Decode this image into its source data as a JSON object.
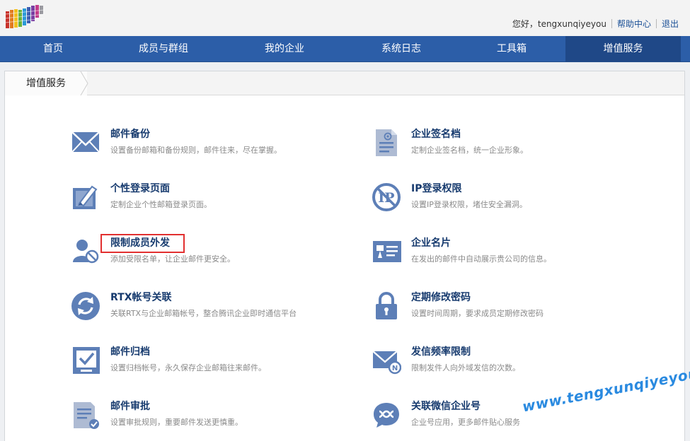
{
  "header": {
    "greeting": "您好，tengxunqiyeyou",
    "help_link": "帮助中心",
    "logout_link": "退出"
  },
  "nav": {
    "items": [
      {
        "label": "首页"
      },
      {
        "label": "成员与群组"
      },
      {
        "label": "我的企业"
      },
      {
        "label": "系统日志"
      },
      {
        "label": "工具箱"
      },
      {
        "label": "增值服务"
      }
    ],
    "active": "增值服务"
  },
  "breadcrumb": {
    "label": "增值服务"
  },
  "services": [
    {
      "title": "邮件备份",
      "desc": "设置备份邮箱和备份规则，邮件往来，尽在掌握。",
      "icon": "envelope-icon"
    },
    {
      "title": "企业签名档",
      "desc": "定制企业签名档，统一企业形象。",
      "icon": "signature-doc-icon"
    },
    {
      "title": "个性登录页面",
      "desc": "定制企业个性邮箱登录页面。",
      "icon": "brush-page-icon"
    },
    {
      "title": "IP登录权限",
      "desc": "设置IP登录权限，堵住安全漏洞。",
      "icon": "ip-block-icon"
    },
    {
      "title": "限制成员外发",
      "desc": "添加受限名单，让企业邮件更安全。",
      "icon": "user-restrict-icon"
    },
    {
      "title": "企业名片",
      "desc": "在发出的邮件中自动展示贵公司的信息。",
      "icon": "business-card-icon"
    },
    {
      "title": "RTX帐号关联",
      "desc": "关联RTX与企业邮箱帐号，整合腾讯企业即时通信平台",
      "icon": "sync-icon"
    },
    {
      "title": "定期修改密码",
      "desc": "设置时间周期，要求成员定期修改密码",
      "icon": "lock-icon"
    },
    {
      "title": "邮件归档",
      "desc": "设置归档帐号，永久保存企业邮箱往来邮件。",
      "icon": "archive-icon"
    },
    {
      "title": "发信频率限制",
      "desc": "限制发件人向外域发信的次数。",
      "icon": "mail-limit-icon"
    },
    {
      "title": "邮件审批",
      "desc": "设置审批规则，重要邮件发送更慎重。",
      "icon": "approval-doc-icon"
    },
    {
      "title": "关联微信企业号",
      "desc": "企业号应用，更多邮件贴心服务",
      "icon": "wechat-link-icon"
    }
  ],
  "watermark": "www.tengxunqiyeyou.com",
  "colors": {
    "nav_bg": "#2c5ea8",
    "nav_active": "#1f4887",
    "title_text": "#163a6e",
    "icon_color": "#5d7fb7",
    "highlight_border": "#e23030",
    "watermark": "#2a8ae0"
  }
}
